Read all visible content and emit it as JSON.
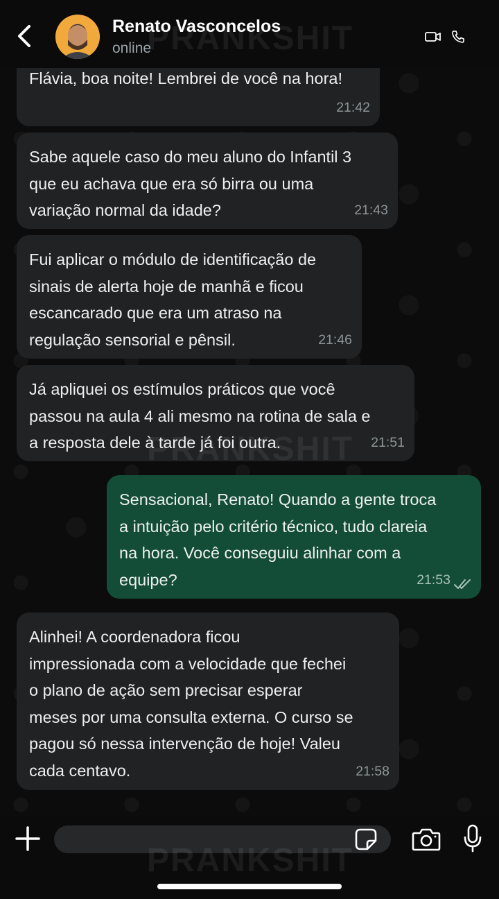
{
  "header": {
    "contact_name": "Renato Vasconcelos",
    "status": "online"
  },
  "watermark": "PRANKSHIT",
  "messages": [
    {
      "direction": "in",
      "text": "Flávia, boa noite! Lembrei de você na hora!",
      "time": "21:42"
    },
    {
      "direction": "in",
      "text": "Sabe aquele caso do meu aluno do Infantil 3\nque eu achava que era só birra ou uma\nvariação normal da idade?",
      "time": "21:43"
    },
    {
      "direction": "in",
      "text": "Fui aplicar o módulo de identificação de\nsinais de alerta hoje de manhã e ficou\nescancarado que era um atraso na\nregulação sensorial e pênsil.",
      "time": "21:46"
    },
    {
      "direction": "in",
      "text": "Já apliquei os estímulos práticos que você\npassou na aula 4 ali mesmo na rotina de sala e\na resposta dele à tarde já foi outra.",
      "time": "21:51"
    },
    {
      "direction": "out",
      "text": "Sensacional, Renato! Quando a gente troca\na intuição pelo critério técnico, tudo clareia\nna hora. Você conseguiu alinhar com a\nequipe?",
      "time": "21:53",
      "status": "read"
    },
    {
      "direction": "in",
      "text": "Alinhei! A coordenadora ficou\nimpressionada com a velocidade que fechei\no plano de ação sem precisar esperar\nmeses por uma consulta externa. O curso se\npagou só nessa intervenção de hoje! Valeu\ncada centavo.",
      "time": "21:58"
    }
  ],
  "input": {
    "placeholder": ""
  },
  "colors": {
    "incoming_bubble": "#202223",
    "outgoing_bubble": "#134d37",
    "background": "#0b0b0b"
  },
  "icons": [
    "back-arrow-icon",
    "video-call-icon",
    "phone-icon",
    "plus-icon",
    "sticker-icon",
    "camera-icon",
    "microphone-icon",
    "double-check-icon"
  ]
}
